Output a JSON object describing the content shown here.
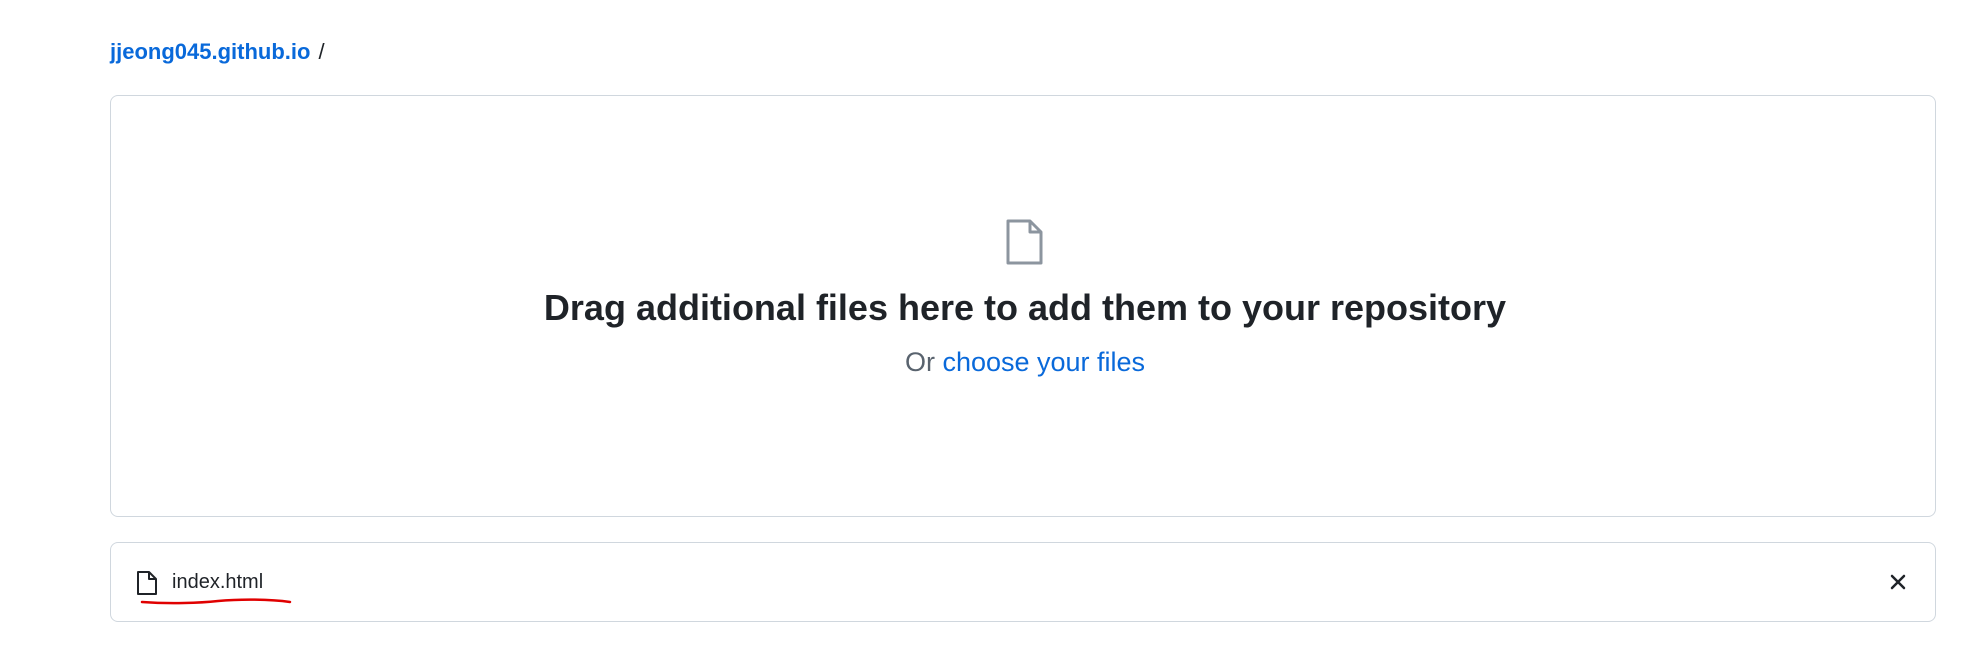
{
  "breadcrumb": {
    "repo_link": "jjeong045.github.io",
    "separator": "/"
  },
  "dropzone": {
    "icon": "file-icon",
    "title": "Drag additional files here to add them to your repository",
    "sub_prefix": "Or",
    "choose_link": "choose your files"
  },
  "uploaded_files": [
    {
      "name": "index.html",
      "icon": "file-icon",
      "remove_icon": "close-icon"
    }
  ],
  "colors": {
    "link": "#0969da",
    "border": "#d0d7de",
    "annotation": "#e00000"
  }
}
